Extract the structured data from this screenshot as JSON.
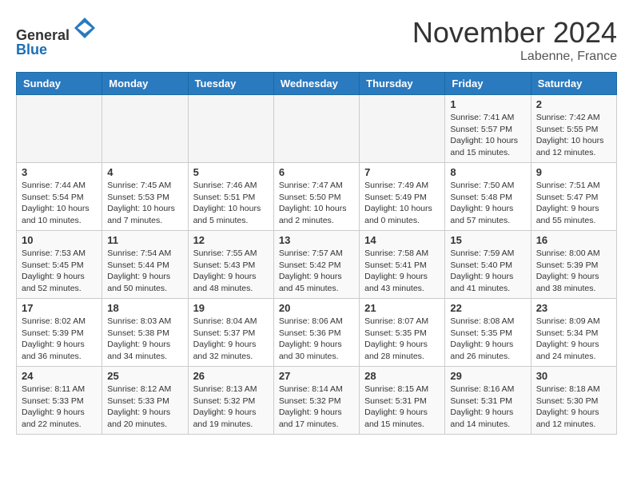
{
  "header": {
    "logo_line1": "General",
    "logo_line2": "Blue",
    "month_title": "November 2024",
    "location": "Labenne, France"
  },
  "weekdays": [
    "Sunday",
    "Monday",
    "Tuesday",
    "Wednesday",
    "Thursday",
    "Friday",
    "Saturday"
  ],
  "weeks": [
    [
      {
        "day": "",
        "info": ""
      },
      {
        "day": "",
        "info": ""
      },
      {
        "day": "",
        "info": ""
      },
      {
        "day": "",
        "info": ""
      },
      {
        "day": "",
        "info": ""
      },
      {
        "day": "1",
        "info": "Sunrise: 7:41 AM\nSunset: 5:57 PM\nDaylight: 10 hours and 15 minutes."
      },
      {
        "day": "2",
        "info": "Sunrise: 7:42 AM\nSunset: 5:55 PM\nDaylight: 10 hours and 12 minutes."
      }
    ],
    [
      {
        "day": "3",
        "info": "Sunrise: 7:44 AM\nSunset: 5:54 PM\nDaylight: 10 hours and 10 minutes."
      },
      {
        "day": "4",
        "info": "Sunrise: 7:45 AM\nSunset: 5:53 PM\nDaylight: 10 hours and 7 minutes."
      },
      {
        "day": "5",
        "info": "Sunrise: 7:46 AM\nSunset: 5:51 PM\nDaylight: 10 hours and 5 minutes."
      },
      {
        "day": "6",
        "info": "Sunrise: 7:47 AM\nSunset: 5:50 PM\nDaylight: 10 hours and 2 minutes."
      },
      {
        "day": "7",
        "info": "Sunrise: 7:49 AM\nSunset: 5:49 PM\nDaylight: 10 hours and 0 minutes."
      },
      {
        "day": "8",
        "info": "Sunrise: 7:50 AM\nSunset: 5:48 PM\nDaylight: 9 hours and 57 minutes."
      },
      {
        "day": "9",
        "info": "Sunrise: 7:51 AM\nSunset: 5:47 PM\nDaylight: 9 hours and 55 minutes."
      }
    ],
    [
      {
        "day": "10",
        "info": "Sunrise: 7:53 AM\nSunset: 5:45 PM\nDaylight: 9 hours and 52 minutes."
      },
      {
        "day": "11",
        "info": "Sunrise: 7:54 AM\nSunset: 5:44 PM\nDaylight: 9 hours and 50 minutes."
      },
      {
        "day": "12",
        "info": "Sunrise: 7:55 AM\nSunset: 5:43 PM\nDaylight: 9 hours and 48 minutes."
      },
      {
        "day": "13",
        "info": "Sunrise: 7:57 AM\nSunset: 5:42 PM\nDaylight: 9 hours and 45 minutes."
      },
      {
        "day": "14",
        "info": "Sunrise: 7:58 AM\nSunset: 5:41 PM\nDaylight: 9 hours and 43 minutes."
      },
      {
        "day": "15",
        "info": "Sunrise: 7:59 AM\nSunset: 5:40 PM\nDaylight: 9 hours and 41 minutes."
      },
      {
        "day": "16",
        "info": "Sunrise: 8:00 AM\nSunset: 5:39 PM\nDaylight: 9 hours and 38 minutes."
      }
    ],
    [
      {
        "day": "17",
        "info": "Sunrise: 8:02 AM\nSunset: 5:39 PM\nDaylight: 9 hours and 36 minutes."
      },
      {
        "day": "18",
        "info": "Sunrise: 8:03 AM\nSunset: 5:38 PM\nDaylight: 9 hours and 34 minutes."
      },
      {
        "day": "19",
        "info": "Sunrise: 8:04 AM\nSunset: 5:37 PM\nDaylight: 9 hours and 32 minutes."
      },
      {
        "day": "20",
        "info": "Sunrise: 8:06 AM\nSunset: 5:36 PM\nDaylight: 9 hours and 30 minutes."
      },
      {
        "day": "21",
        "info": "Sunrise: 8:07 AM\nSunset: 5:35 PM\nDaylight: 9 hours and 28 minutes."
      },
      {
        "day": "22",
        "info": "Sunrise: 8:08 AM\nSunset: 5:35 PM\nDaylight: 9 hours and 26 minutes."
      },
      {
        "day": "23",
        "info": "Sunrise: 8:09 AM\nSunset: 5:34 PM\nDaylight: 9 hours and 24 minutes."
      }
    ],
    [
      {
        "day": "24",
        "info": "Sunrise: 8:11 AM\nSunset: 5:33 PM\nDaylight: 9 hours and 22 minutes."
      },
      {
        "day": "25",
        "info": "Sunrise: 8:12 AM\nSunset: 5:33 PM\nDaylight: 9 hours and 20 minutes."
      },
      {
        "day": "26",
        "info": "Sunrise: 8:13 AM\nSunset: 5:32 PM\nDaylight: 9 hours and 19 minutes."
      },
      {
        "day": "27",
        "info": "Sunrise: 8:14 AM\nSunset: 5:32 PM\nDaylight: 9 hours and 17 minutes."
      },
      {
        "day": "28",
        "info": "Sunrise: 8:15 AM\nSunset: 5:31 PM\nDaylight: 9 hours and 15 minutes."
      },
      {
        "day": "29",
        "info": "Sunrise: 8:16 AM\nSunset: 5:31 PM\nDaylight: 9 hours and 14 minutes."
      },
      {
        "day": "30",
        "info": "Sunrise: 8:18 AM\nSunset: 5:30 PM\nDaylight: 9 hours and 12 minutes."
      }
    ]
  ]
}
